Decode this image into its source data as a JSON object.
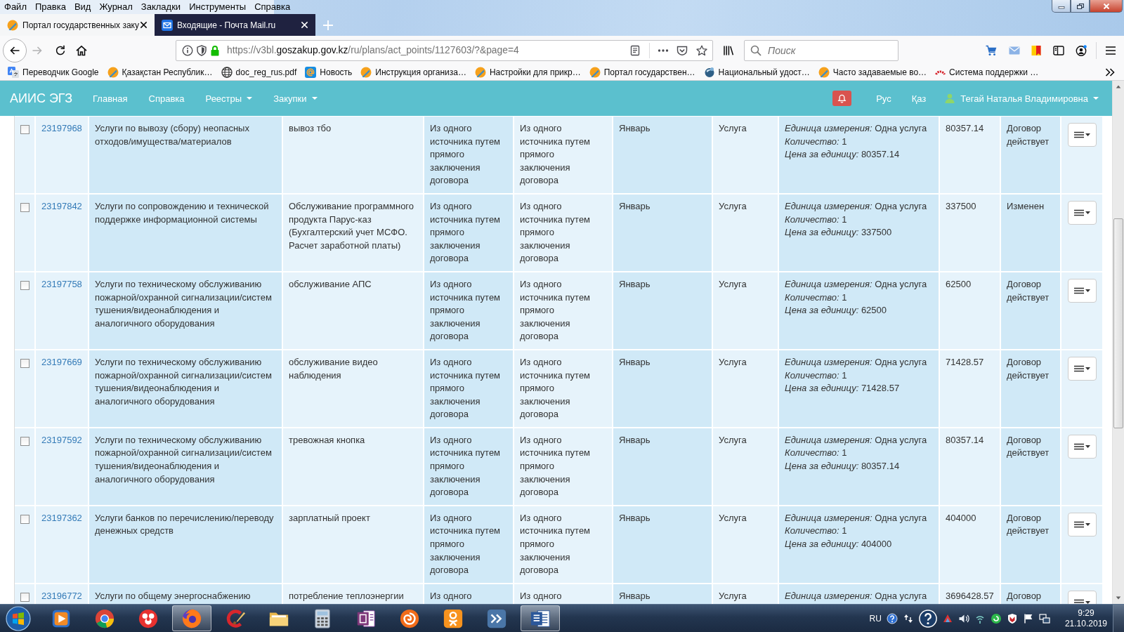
{
  "menu_bar": [
    "Файл",
    "Правка",
    "Вид",
    "Журнал",
    "Закладки",
    "Инструменты",
    "Справка"
  ],
  "tabs": [
    {
      "title": "Портал государственных заку",
      "selected": true
    },
    {
      "title": "Входящие - Почта Mail.ru",
      "selected": false
    }
  ],
  "address_bar": {
    "url_start": "https://v3bl.",
    "url_domain": "goszakup.gov.kz",
    "url_path": "/ru/plans/act_points/1127603/?&page=4"
  },
  "search": {
    "placeholder": "Поиск"
  },
  "bookmarks": [
    "Переводчик Google",
    "Қазақстан Республик…",
    "doc_reg_rus.pdf",
    "Новость",
    "Инструкция организа…",
    "Настройки для прикр…",
    "Портал государствен…",
    "Национальный удост…",
    "Часто задаваемые во…",
    "Система поддержки …"
  ],
  "navbar": {
    "brand": "АИИС ЭГЗ",
    "links": [
      {
        "label": "Главная",
        "dropdown": false
      },
      {
        "label": "Справка",
        "dropdown": false
      },
      {
        "label": "Реестры",
        "dropdown": true
      },
      {
        "label": "Закупки",
        "dropdown": true
      }
    ],
    "languages": [
      "Рус",
      "Қаз"
    ],
    "user": {
      "name": "Тегай Наталья Владимировна",
      "dropdown": true
    }
  },
  "table": {
    "rows": [
      {
        "checked": false,
        "column_2": "23197968",
        "column_3": "Услуги по вывозу (сбору) неопасных отходов/имущества/материалов",
        "column_4": "вывоз тбо",
        "column_5": "Из одного источника путем прямого заключения договора",
        "column_6": "Из одного источника путем прямого заключения договора",
        "column_7": "Январь",
        "column_8": "Услуга",
        "column_9": [
          {
            "label": "Единица измерения:",
            "value": "Одна услуга"
          },
          {
            "label": "Количество:",
            "value": "1"
          },
          {
            "label": "Цена за единицу:",
            "value": "80357.14"
          }
        ],
        "column_10": "80357.14",
        "column_11": "Договор действует"
      },
      {
        "checked": false,
        "column_2": "23197842",
        "column_3": "Услуги по сопровождению и технической поддержке информационной системы",
        "column_4": "Обслуживание программного продукта Парус-каз (Бухгалтерский учет МСФО. Расчет заработной платы)",
        "column_5": "Из одного источника путем прямого заключения договора",
        "column_6": "Из одного источника путем прямого заключения договора",
        "column_7": "Январь",
        "column_8": "Услуга",
        "column_9": [
          {
            "label": "Единица измерения:",
            "value": "Одна услуга"
          },
          {
            "label": "Количество:",
            "value": "1"
          },
          {
            "label": "Цена за единицу:",
            "value": "337500"
          }
        ],
        "column_10": "337500",
        "column_11": "Изменен"
      },
      {
        "checked": false,
        "column_2": "23197758",
        "column_3": "Услуги по техническому обслуживанию пожарной/охранной сигнализации/систем тушения/видеонаблюдения и аналогичного оборудования",
        "column_4": "обслуживание АПС",
        "column_5": "Из одного источника путем прямого заключения договора",
        "column_6": "Из одного источника путем прямого заключения договора",
        "column_7": "Январь",
        "column_8": "Услуга",
        "column_9": [
          {
            "label": "Единица измерения:",
            "value": "Одна услуга"
          },
          {
            "label": "Количество:",
            "value": "1"
          },
          {
            "label": "Цена за единицу:",
            "value": "62500"
          }
        ],
        "column_10": "62500",
        "column_11": "Договор действует"
      },
      {
        "checked": false,
        "column_2": "23197669",
        "column_3": "Услуги по техническому обслуживанию пожарной/охранной сигнализации/систем тушения/видеонаблюдения и аналогичного оборудования",
        "column_4": "обслуживание видео наблюдения",
        "column_5": "Из одного источника путем прямого заключения договора",
        "column_6": "Из одного источника путем прямого заключения договора",
        "column_7": "Январь",
        "column_8": "Услуга",
        "column_9": [
          {
            "label": "Единица измерения:",
            "value": "Одна услуга"
          },
          {
            "label": "Количество:",
            "value": "1"
          },
          {
            "label": "Цена за единицу:",
            "value": "71428.57"
          }
        ],
        "column_10": "71428.57",
        "column_11": "Договор действует"
      },
      {
        "checked": false,
        "column_2": "23197592",
        "column_3": "Услуги по техническому обслуживанию пожарной/охранной сигнализации/систем тушения/видеонаблюдения и аналогичного оборудования",
        "column_4": "тревожная кнопка",
        "column_5": "Из одного источника путем прямого заключения договора",
        "column_6": "Из одного источника путем прямого заключения договора",
        "column_7": "Январь",
        "column_8": "Услуга",
        "column_9": [
          {
            "label": "Единица измерения:",
            "value": "Одна услуга"
          },
          {
            "label": "Количество:",
            "value": "1"
          },
          {
            "label": "Цена за единицу:",
            "value": "80357.14"
          }
        ],
        "column_10": "80357.14",
        "column_11": "Договор действует"
      },
      {
        "checked": false,
        "column_2": "23197362",
        "column_3": "Услуги банков по перечислению/переводу денежных средств",
        "column_4": "зарплатный проект",
        "column_5": "Из одного источника путем прямого заключения договора",
        "column_6": "Из одного источника путем прямого заключения договора",
        "column_7": "Январь",
        "column_8": "Услуга",
        "column_9": [
          {
            "label": "Единица измерения:",
            "value": "Одна услуга"
          },
          {
            "label": "Количество:",
            "value": "1"
          },
          {
            "label": "Цена за единицу:",
            "value": "404000"
          }
        ],
        "column_10": "404000",
        "column_11": "Договор действует"
      },
      {
        "checked": false,
        "column_2": "23196772",
        "column_3": "Услуги по общему энергоснабжению",
        "column_4": "потребление теплоэнергии",
        "column_5": "Из одного",
        "column_6": "Из одного",
        "column_7": "Январь",
        "column_8": "Услуга",
        "column_9": [
          {
            "label": "Единица измерения:",
            "value": "Одна услуга"
          }
        ],
        "column_10": "3696428.57",
        "column_11": "Договор"
      }
    ]
  },
  "taskbar": {
    "apps": [
      {
        "open": false
      },
      {
        "open": false
      },
      {
        "open": false
      },
      {
        "open": true
      },
      {
        "open": false
      },
      {
        "open": false
      },
      {
        "open": false
      },
      {
        "open": false
      },
      {
        "open": false
      },
      {
        "open": false
      },
      {
        "open": false
      },
      {
        "open": true
      }
    ],
    "language": "RU",
    "time": "9:29",
    "date": "21.10.2019"
  }
}
